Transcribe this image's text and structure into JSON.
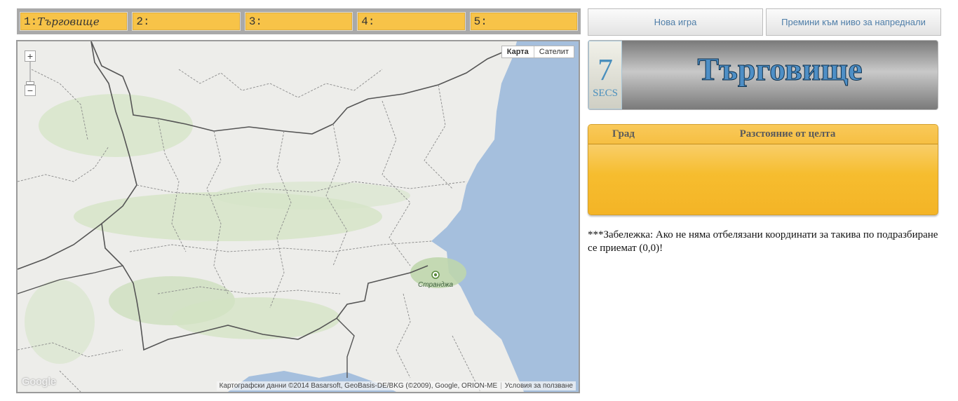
{
  "slots": [
    {
      "number": "1:",
      "city": "Търговище"
    },
    {
      "number": "2:",
      "city": ""
    },
    {
      "number": "3:",
      "city": ""
    },
    {
      "number": "4:",
      "city": ""
    },
    {
      "number": "5:",
      "city": ""
    }
  ],
  "buttons": {
    "new_game": "Нова игра",
    "advanced": "Премини към ниво за напреднали"
  },
  "timer": {
    "value": "7",
    "label": "SECS"
  },
  "target_city": "Търговище",
  "results": {
    "headers": {
      "city": "Град",
      "distance": "Разстояние от целта"
    },
    "rows": []
  },
  "note": "***Забележка: Ако не няма отбелязани координати за такива по подразбиране се приемат (0,0)!",
  "map": {
    "zoom_in": "+",
    "zoom_out": "−",
    "type_map": "Карта",
    "type_satellite": "Сателит",
    "poi_label": "Странджа",
    "attribution": "Картографски данни ©2014 Basarsoft, GeoBasis-DE/BKG (©2009), Google, ORION-ME",
    "terms": "Условия за ползване",
    "logo": "Google",
    "colors": {
      "sea": "#a5bfdd",
      "land": "#ededea",
      "forest": "#cfe0c0",
      "border": "#555555"
    }
  }
}
